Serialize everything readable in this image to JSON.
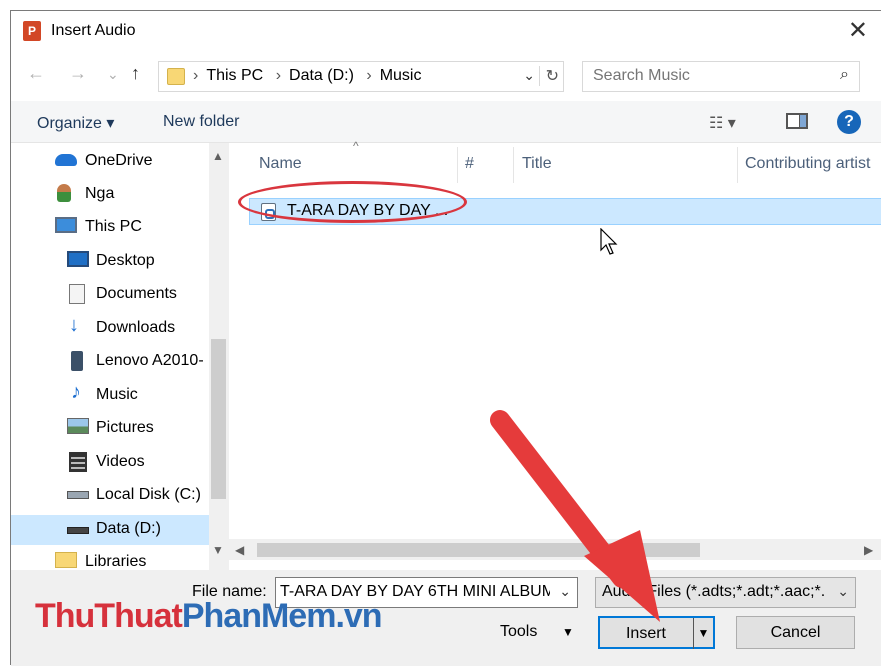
{
  "window": {
    "title": "Insert Audio",
    "close_glyph": "✕"
  },
  "nav": {
    "back": "←",
    "forward": "→",
    "recent": "⌄",
    "up": "↑"
  },
  "address": {
    "crumbs": [
      "This PC",
      "Data (D:)",
      "Music"
    ],
    "separator": "›",
    "dropdown": "⌄",
    "refresh": "↻"
  },
  "search": {
    "placeholder": "Search Music",
    "icon": "⌕"
  },
  "toolbar": {
    "organize": "Organize ▾",
    "new_folder": "New folder",
    "view_glyph": "☷ ▾",
    "help": "?"
  },
  "sidebar": {
    "items": [
      {
        "label": "OneDrive",
        "icon": "cloud-icon"
      },
      {
        "label": "Nga",
        "icon": "user-icon"
      },
      {
        "label": "This PC",
        "icon": "computer-icon"
      },
      {
        "label": "Desktop",
        "icon": "desktop-icon"
      },
      {
        "label": "Documents",
        "icon": "documents-icon"
      },
      {
        "label": "Downloads",
        "icon": "downloads-icon"
      },
      {
        "label": "Lenovo A2010-",
        "icon": "phone-icon"
      },
      {
        "label": "Music",
        "icon": "music-icon"
      },
      {
        "label": "Pictures",
        "icon": "pictures-icon"
      },
      {
        "label": "Videos",
        "icon": "videos-icon"
      },
      {
        "label": "Local Disk (C:)",
        "icon": "drive-icon"
      },
      {
        "label": "Data (D:)",
        "icon": "drive-icon"
      },
      {
        "label": "Libraries",
        "icon": "libraries-icon"
      }
    ]
  },
  "files": {
    "columns": [
      "Name",
      "#",
      "Title",
      "Contributing artist"
    ],
    "rows": [
      {
        "name": "T-ARA DAY BY DAY ..."
      }
    ]
  },
  "bottom": {
    "filename_label": "File name:",
    "filename_value": "T-ARA DAY BY DAY 6TH MINI ALBUM",
    "filetype_value": "Audio Files (*.adts;*.adt;*.aac;*.",
    "tools": "Tools",
    "insert": "Insert",
    "cancel": "Cancel"
  },
  "watermark": {
    "part1": "ThuThuat",
    "part2": "PhanMem",
    "part3": ".vn"
  },
  "colors": {
    "accent": "#0078d7",
    "selection": "#cce8ff",
    "annotation": "#d9363e"
  }
}
